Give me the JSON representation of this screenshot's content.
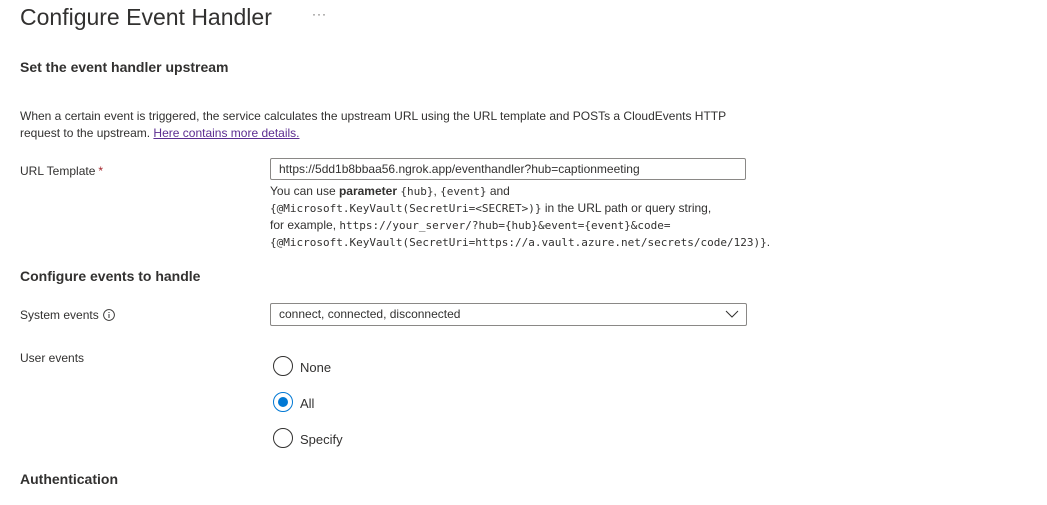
{
  "page": {
    "title": "Configure Event Handler",
    "more_glyph": "···"
  },
  "upstream_section": {
    "heading": "Set the event handler upstream",
    "description": "When a certain event is triggered, the service calculates the upstream URL using the URL template and POSTs a CloudEvents HTTP request to the upstream.",
    "details_link": "Here contains more details."
  },
  "url_template": {
    "label": "URL Template",
    "required_marker": "*",
    "value": "https://5dd1b8bbaa56.ngrok.app/eventhandler?hub=captionmeeting",
    "help": {
      "t1": "You can use ",
      "t2": "parameter",
      "t3": " ",
      "code_hub": "{hub}",
      "t4": ", ",
      "code_event": "{event}",
      "t5": " and",
      "code_keyvault": "{@Microsoft.KeyVault(SecretUri=<SECRET>)}",
      "t6": " in the URL path or query string,",
      "t7": "for example, ",
      "code_example1": "https://your_server/?hub={hub}&event={event}&code=",
      "code_example2": "{@Microsoft.KeyVault(SecretUri=https://a.vault.azure.net/secrets/code/123)}",
      "t8": "."
    }
  },
  "events_section": {
    "heading": "Configure events to handle",
    "system_events": {
      "label": "System events",
      "info_icon": "info-icon",
      "selected_value": "connect, connected, disconnected",
      "chevron_icon": "chevron-down-icon"
    },
    "user_events": {
      "label": "User events",
      "options": [
        {
          "label": "None",
          "selected": false
        },
        {
          "label": "All",
          "selected": true
        },
        {
          "label": "Specify",
          "selected": false
        }
      ]
    }
  },
  "auth_section": {
    "heading": "Authentication"
  },
  "colors": {
    "accent": "#0078d4",
    "link_visited": "#5c2d91",
    "required": "#a4262c",
    "text": "#323130",
    "border": "#8a8886"
  }
}
